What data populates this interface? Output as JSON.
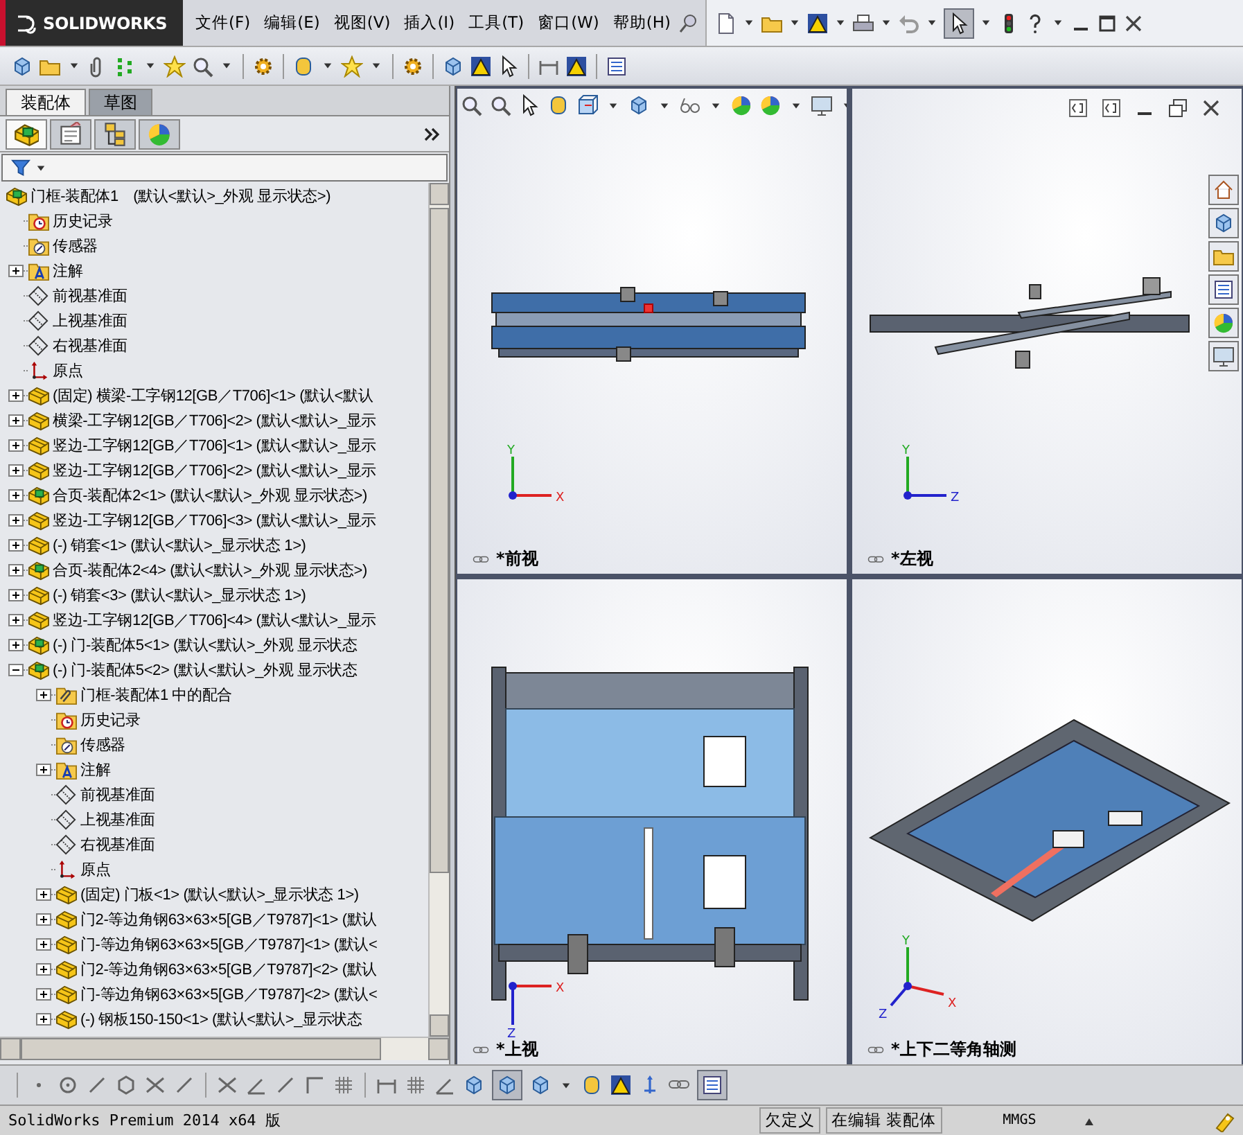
{
  "app": {
    "logo": "SOLIDWORKS"
  },
  "menu": [
    "文件(F)",
    "编辑(E)",
    "视图(V)",
    "插入(I)",
    "工具(T)",
    "窗口(W)",
    "帮助(H)"
  ],
  "panel_tabs": [
    {
      "label": "装配体",
      "selected": true
    },
    {
      "label": "草图",
      "selected": false
    }
  ],
  "manager_tabs": [
    {
      "kind": "feature",
      "selected": true
    },
    {
      "kind": "property",
      "selected": false
    },
    {
      "kind": "config",
      "selected": false
    },
    {
      "kind": "display",
      "selected": false
    }
  ],
  "tree": {
    "label": "门框-装配体1　(默认<默认>_外观 显示状态>)",
    "kind": "assembly",
    "children": [
      {
        "label": "历史记录",
        "kind": "history"
      },
      {
        "label": "传感器",
        "kind": "sensor"
      },
      {
        "label": "注解",
        "kind": "annotation",
        "expanded": false
      },
      {
        "label": "前视基准面",
        "kind": "plane"
      },
      {
        "label": "上视基准面",
        "kind": "plane"
      },
      {
        "label": "右视基准面",
        "kind": "plane"
      },
      {
        "label": "原点",
        "kind": "origin"
      },
      {
        "label": "(固定) 横梁-工字钢12[GB／T706]<1> (默认<默认",
        "kind": "part",
        "expanded": false
      },
      {
        "label": "横梁-工字钢12[GB／T706]<2> (默认<默认>_显示",
        "kind": "part",
        "expanded": false
      },
      {
        "label": "竖边-工字钢12[GB／T706]<1> (默认<默认>_显示",
        "kind": "part",
        "expanded": false
      },
      {
        "label": "竖边-工字钢12[GB／T706]<2> (默认<默认>_显示",
        "kind": "part",
        "expanded": false
      },
      {
        "label": "合页-装配体2<1> (默认<默认>_外观 显示状态>)",
        "kind": "assembly",
        "expanded": false
      },
      {
        "label": "竖边-工字钢12[GB／T706]<3> (默认<默认>_显示",
        "kind": "part",
        "expanded": false
      },
      {
        "label": "(-) 销套<1> (默认<默认>_显示状态 1>)",
        "kind": "part",
        "expanded": false
      },
      {
        "label": "合页-装配体2<4> (默认<默认>_外观 显示状态>)",
        "kind": "assembly",
        "expanded": false
      },
      {
        "label": "(-) 销套<3> (默认<默认>_显示状态 1>)",
        "kind": "part",
        "expanded": false
      },
      {
        "label": "竖边-工字钢12[GB／T706]<4> (默认<默认>_显示",
        "kind": "part",
        "expanded": false
      },
      {
        "label": "(-) 门-装配体5<1> (默认<默认>_外观 显示状态",
        "kind": "assembly",
        "expanded": false
      },
      {
        "label": "(-) 门-装配体5<2> (默认<默认>_外观 显示状态",
        "kind": "assembly",
        "expanded": true,
        "children": [
          {
            "label": "门框-装配体1 中的配合",
            "kind": "mates",
            "expanded": false
          },
          {
            "label": "历史记录",
            "kind": "history"
          },
          {
            "label": "传感器",
            "kind": "sensor"
          },
          {
            "label": "注解",
            "kind": "annotation",
            "expanded": false
          },
          {
            "label": "前视基准面",
            "kind": "plane"
          },
          {
            "label": "上视基准面",
            "kind": "plane"
          },
          {
            "label": "右视基准面",
            "kind": "plane"
          },
          {
            "label": "原点",
            "kind": "origin"
          },
          {
            "label": "(固定) 门板<1> (默认<默认>_显示状态 1>)",
            "kind": "part",
            "expanded": false
          },
          {
            "label": "门2-等边角钢63×63×5[GB／T9787]<1> (默认",
            "kind": "part",
            "expanded": false
          },
          {
            "label": "门-等边角钢63×63×5[GB／T9787]<1> (默认<",
            "kind": "part",
            "expanded": false
          },
          {
            "label": "门2-等边角钢63×63×5[GB／T9787]<2> (默认",
            "kind": "part",
            "expanded": false
          },
          {
            "label": "门-等边角钢63×63×5[GB／T9787]<2> (默认<",
            "kind": "part",
            "expanded": false
          },
          {
            "label": "(-) 钢板150-150<1> (默认<默认>_显示状态",
            "kind": "part",
            "expanded": false
          }
        ]
      }
    ]
  },
  "viewports": [
    {
      "kind": "front",
      "label": "*前视",
      "axes": [
        "Y",
        "X"
      ]
    },
    {
      "kind": "left",
      "label": "*左视",
      "axes": [
        "Y",
        "Z"
      ]
    },
    {
      "kind": "top",
      "label": "*上视",
      "axes": [
        "X",
        "Z"
      ]
    },
    {
      "kind": "iso",
      "label": "*上下二等角轴测",
      "axes": [
        "Y",
        "Z",
        "X"
      ]
    }
  ],
  "status_bar": {
    "product": "SolidWorks Premium 2014 x64 版",
    "state": "欠定义",
    "mode": "在编辑 装配体",
    "units": "MMGS"
  }
}
